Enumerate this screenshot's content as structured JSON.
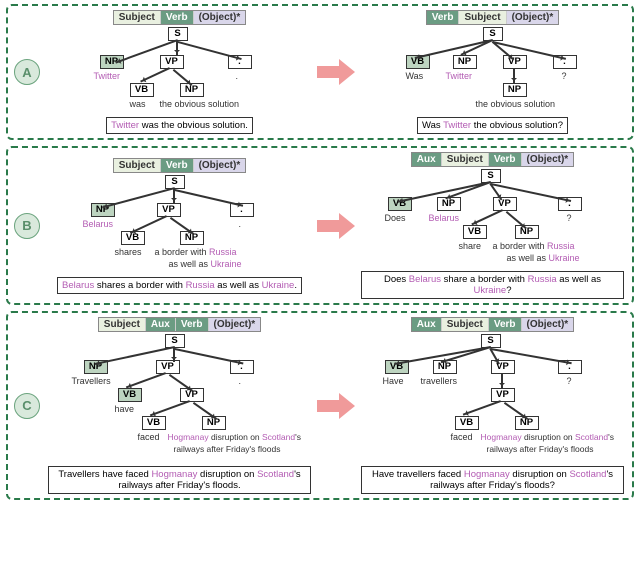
{
  "labels": {
    "subject": "Subject",
    "verb": "Verb",
    "aux": "Aux",
    "object": "(Object)*"
  },
  "chart_data": {
    "type": "diagram",
    "description": "Three examples (A, B, C) showing syntactic transformation of declarative sentences into interrogative sentences via constituency tree rearrangement.",
    "examples": [
      {
        "id": "A",
        "left": {
          "pattern": [
            "Subject",
            "Verb",
            "(Object)*"
          ],
          "tree": {
            "S": [
              {
                "NP": "Twitter",
                "fill": true
              },
              {
                "VP": [
                  {
                    "VB": "was"
                  },
                  {
                    "NP": "the obvious solution"
                  }
                ]
              },
              {
                ".": "."
              }
            ]
          },
          "sentence": "Twitter was the obvious solution.",
          "entities": [
            "Twitter"
          ]
        },
        "right": {
          "pattern": [
            "Verb",
            "Subject",
            "(Object)*"
          ],
          "tree": {
            "S": [
              {
                "VB": "Was",
                "fill": true
              },
              {
                "NP": "Twitter"
              },
              {
                "VP": [
                  {
                    "NP": "the obvious solution"
                  }
                ]
              },
              {
                ".": "?"
              }
            ]
          },
          "sentence": "Was Twitter the obvious solution?",
          "entities": [
            "Twitter"
          ]
        }
      },
      {
        "id": "B",
        "left": {
          "pattern": [
            "Subject",
            "Verb",
            "(Object)*"
          ],
          "tree": {
            "S": [
              {
                "NP": "Belarus",
                "fill": true
              },
              {
                "VP": [
                  {
                    "VB": "shares"
                  },
                  {
                    "NP": "a border with Russia as well as Ukraine"
                  }
                ]
              },
              {
                ".": "."
              }
            ]
          },
          "sentence": "Belarus shares a border with Russia as well as Ukraine.",
          "entities": [
            "Belarus",
            "Russia",
            "Ukraine"
          ]
        },
        "right": {
          "pattern": [
            "Aux",
            "Subject",
            "Verb",
            "(Object)*"
          ],
          "tree": {
            "S": [
              {
                "VB": "Does",
                "fill": true
              },
              {
                "NP": "Belarus"
              },
              {
                "VP": [
                  {
                    "VB": "share"
                  },
                  {
                    "NP": "a border with Russia as well as Ukraine"
                  }
                ]
              },
              {
                ".": "?"
              }
            ]
          },
          "sentence": "Does Belarus share a border with Russia as well as Ukraine?",
          "entities": [
            "Belarus",
            "Russia",
            "Ukraine"
          ]
        }
      },
      {
        "id": "C",
        "left": {
          "pattern": [
            "Subject",
            "Aux",
            "Verb",
            "(Object)*"
          ],
          "tree": {
            "S": [
              {
                "NP": "Travellers",
                "fill": true
              },
              {
                "VP": [
                  {
                    "VB": "have",
                    "fill": true
                  },
                  {
                    "VP": [
                      {
                        "VB": "faced"
                      },
                      {
                        "NP": "Hogmanay disruption on Scotland's railways after Friday's floods"
                      }
                    ]
                  }
                ]
              },
              {
                ".": "."
              }
            ]
          },
          "sentence": "Travellers have faced Hogmanay disruption on Scotland's railways after Friday's floods.",
          "entities": [
            "Hogmanay",
            "Scotland"
          ]
        },
        "right": {
          "pattern": [
            "Aux",
            "Subject",
            "Verb",
            "(Object)*"
          ],
          "tree": {
            "S": [
              {
                "VB": "Have",
                "fill": true
              },
              {
                "NP": "travellers"
              },
              {
                "VP": [
                  {
                    "VP": [
                      {
                        "VB": "faced"
                      },
                      {
                        "NP": "Hogmanay disruption on Scotland's railways after Friday's floods"
                      }
                    ]
                  }
                ]
              },
              {
                ".": "?"
              }
            ]
          },
          "sentence": "Have travellers faced Hogmanay disruption on Scotland's railways after Friday's floods?",
          "entities": [
            "Hogmanay",
            "Scotland"
          ]
        }
      }
    ]
  },
  "panelA": {
    "badge": "A",
    "left_sentence_html": "<span class='ent'>Twitter</span> was the obvious solution.",
    "right_sentence_html": "Was <span class='ent'>Twitter</span> the obvious solution?",
    "l_np": "NP",
    "l_vp": "VP",
    "l_s": "S",
    "l_vb": "VB",
    "l_dot": ".",
    "l_twitter": "Twitter",
    "l_was": "was",
    "l_obj": "the obvious solution",
    "l_period": ".",
    "r_was": "Was",
    "r_twitter": "Twitter",
    "r_obj": "the obvious solution",
    "r_q": "?"
  },
  "panelB": {
    "badge": "B",
    "left_sentence_html": "<span class='ent'>Belarus</span> shares a border with <span class='ent'>Russia</span> as well as <span class='ent'>Ukraine</span>.",
    "right_sentence_html": "Does <span class='ent'>Belarus</span> share a border with <span class='ent'>Russia</span> as well as <span class='ent'>Ukraine</span>?",
    "l_belarus": "Belarus",
    "l_shares": "shares",
    "l_obj1": "a border with <span class='ent'>Russia</span>",
    "l_obj2": "as well as <span class='ent'>Ukraine</span>",
    "r_does": "Does",
    "r_belarus": "Belarus",
    "r_share": "share",
    "r_q": "?"
  },
  "panelC": {
    "badge": "C",
    "left_sentence_html": "Travellers have faced <span class='ent'>Hogmanay</span> disruption on <span class='ent'>Scotland</span>'s railways after Friday's floods.",
    "right_sentence_html": "Have travellers faced <span class='ent'>Hogmanay</span> disruption on <span class='ent'>Scotland</span>'s railways after Friday's floods?",
    "l_trav": "Travellers",
    "l_have": "have",
    "l_faced": "faced",
    "l_objA": "<span class='ent'>Hogmanay</span> disruption on <span class='ent'>Scotland</span>'s",
    "l_objB": "railways after Friday's floods",
    "r_have": "Have",
    "r_trav": "travellers",
    "r_faced": "faced",
    "r_q": "?"
  }
}
